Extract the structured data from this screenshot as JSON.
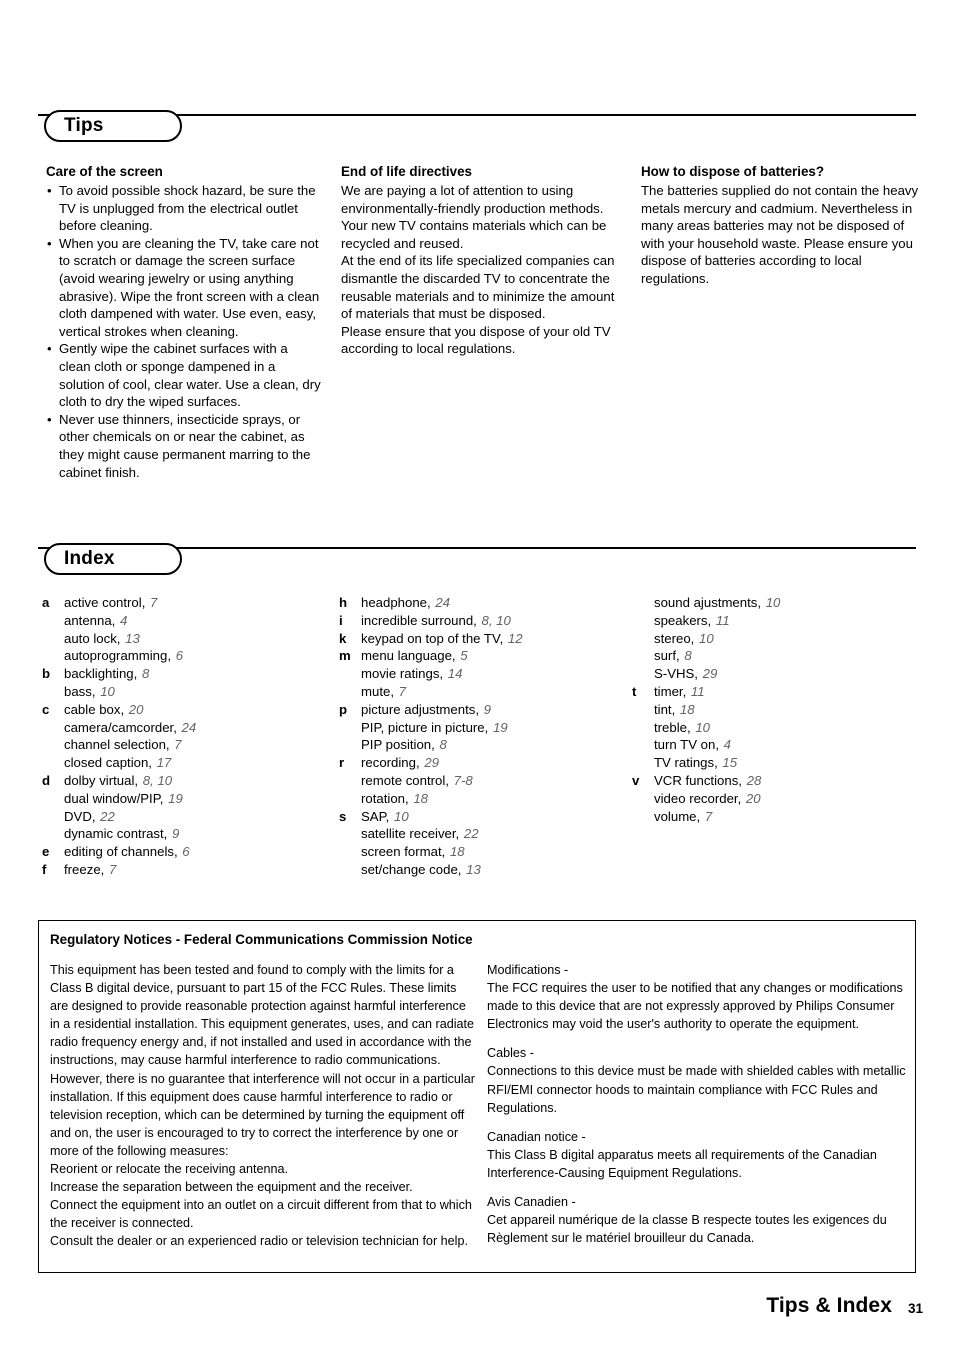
{
  "sections": {
    "tips": {
      "label": "Tips"
    },
    "index": {
      "label": "Index"
    }
  },
  "tips": {
    "care": {
      "heading": "Care of the screen",
      "bullets": [
        "To avoid possible shock hazard, be sure the TV is unplugged from the electrical outlet before cleaning.",
        "When you are cleaning the TV, take care not to scratch or damage the screen surface (avoid wearing jewelry or using anything abrasive). Wipe the front screen with a clean cloth dampened with water. Use even, easy, vertical strokes when cleaning.",
        "Gently wipe the cabinet surfaces with a clean cloth or sponge dampened in a solution of cool, clear water. Use a clean, dry cloth to dry the wiped surfaces.",
        "Never use thinners, insecticide sprays, or other chemicals on or near the cabinet, as they might cause permanent marring to the cabinet finish."
      ]
    },
    "end_of_life": {
      "heading": "End of life directives",
      "paragraphs": [
        "We are paying a lot of attention to using environmentally-friendly production methods. Your new TV contains materials which can be recycled and reused.",
        "At the end of its life specialized companies can dismantle the discarded TV to concentrate the reusable materials and to minimize the amount of materials that must be disposed.",
        "Please ensure that you dispose of your old TV according to local regulations."
      ]
    },
    "batteries": {
      "heading": "How to dispose of batteries?",
      "paragraphs": [
        "The batteries supplied do not contain the heavy metals mercury and cadmium. Nevertheless in many areas batteries may not be disposed of with your household waste. Please ensure you dispose of batteries according to local regulations."
      ]
    },
    "bullet_glyph": "•"
  },
  "index": {
    "column1": [
      {
        "letter": "a",
        "term": "active control,",
        "page": "7"
      },
      {
        "letter": "",
        "term": "antenna,",
        "page": "4"
      },
      {
        "letter": "",
        "term": "auto lock,",
        "page": "13"
      },
      {
        "letter": "",
        "term": "autoprogramming,",
        "page": "6"
      },
      {
        "letter": "b",
        "term": "backlighting,",
        "page": "8"
      },
      {
        "letter": "",
        "term": "bass,",
        "page": "10"
      },
      {
        "letter": "c",
        "term": "cable box,",
        "page": "20"
      },
      {
        "letter": "",
        "term": "camera/camcorder,",
        "page": "24"
      },
      {
        "letter": "",
        "term": "channel selection,",
        "page": "7"
      },
      {
        "letter": "",
        "term": "closed caption,",
        "page": "17"
      },
      {
        "letter": "d",
        "term": "dolby virtual,",
        "page": "8, 10"
      },
      {
        "letter": "",
        "term": "dual window/PIP,",
        "page": "19"
      },
      {
        "letter": "",
        "term": "DVD,",
        "page": "22"
      },
      {
        "letter": "",
        "term": "dynamic contrast,",
        "page": "9"
      },
      {
        "letter": "e",
        "term": "editing of channels,",
        "page": "6"
      },
      {
        "letter": "f",
        "term": "freeze,",
        "page": "7"
      }
    ],
    "column2": [
      {
        "letter": "h",
        "term": "headphone,",
        "page": "24"
      },
      {
        "letter": "i",
        "term": "incredible surround,",
        "page": "8, 10"
      },
      {
        "letter": "k",
        "term": "keypad on top of the TV,",
        "page": "12"
      },
      {
        "letter": "m",
        "term": "menu language,",
        "page": "5"
      },
      {
        "letter": "",
        "term": "movie ratings,",
        "page": "14"
      },
      {
        "letter": "",
        "term": "mute,",
        "page": "7"
      },
      {
        "letter": "p",
        "term": "picture adjustments,",
        "page": "9"
      },
      {
        "letter": "",
        "term": "PIP, picture in picture,",
        "page": "19"
      },
      {
        "letter": "",
        "term": "PIP position,",
        "page": "8"
      },
      {
        "letter": "r",
        "term": "recording,",
        "page": "29"
      },
      {
        "letter": "",
        "term": "remote control,",
        "page": "7-8"
      },
      {
        "letter": "",
        "term": "rotation,",
        "page": "18"
      },
      {
        "letter": "s",
        "term": "SAP,",
        "page": "10"
      },
      {
        "letter": "",
        "term": "satellite receiver,",
        "page": "22"
      },
      {
        "letter": "",
        "term": "screen format,",
        "page": "18"
      },
      {
        "letter": "",
        "term": "set/change code,",
        "page": "13"
      }
    ],
    "column3": [
      {
        "letter": "",
        "term": "sound ajustments,",
        "page": "10"
      },
      {
        "letter": "",
        "term": "speakers,",
        "page": "11"
      },
      {
        "letter": "",
        "term": "stereo,",
        "page": "10"
      },
      {
        "letter": "",
        "term": "surf,",
        "page": "8"
      },
      {
        "letter": "",
        "term": "S-VHS,",
        "page": "29"
      },
      {
        "letter": "t",
        "term": "timer,",
        "page": "11"
      },
      {
        "letter": "",
        "term": "tint,",
        "page": "18"
      },
      {
        "letter": "",
        "term": "treble,",
        "page": "10"
      },
      {
        "letter": "",
        "term": "turn TV on,",
        "page": "4"
      },
      {
        "letter": "",
        "term": "TV ratings,",
        "page": "15"
      },
      {
        "letter": "v",
        "term": "VCR functions,",
        "page": "28"
      },
      {
        "letter": "",
        "term": "video recorder,",
        "page": "20"
      },
      {
        "letter": "",
        "term": "volume,",
        "page": "7"
      }
    ]
  },
  "regulatory": {
    "title": "Regulatory Notices - Federal Communications Commission Notice",
    "left_paragraphs": [
      "This equipment has been tested and found to comply with the limits for a Class B digital device, pursuant to part 15 of the FCC Rules. These limits are designed to provide reasonable protection against harmful interference in a residential installation. This equipment generates, uses, and can radiate radio frequency energy and, if not installed and used in accordance with the instructions, may cause harmful interference to radio communications. However, there is no guarantee that interference will not occur in a particular installation. If this equipment does cause harmful interference to radio or television reception, which can be determined by turning the equipment off and on, the user is encouraged to try to correct the interference by one or more of the following measures:",
      "Reorient or relocate the receiving antenna.",
      "Increase the separation between the equipment and the receiver.",
      "Connect the equipment into an outlet on a circuit different from that to which the receiver is connected.",
      "Consult the dealer or an experienced radio or television technician for help."
    ],
    "right_blocks": [
      {
        "heading": "Modifications -",
        "body": "The FCC requires the user to be notified that any changes or modifications made to this device that are not expressly approved by Philips Consumer Electronics may void the user's authority to operate the equipment."
      },
      {
        "heading": "Cables -",
        "body": "Connections to this device must be made with shielded cables with metallic RFI/EMI connector hoods to maintain compliance with FCC Rules and Regulations."
      },
      {
        "heading": "Canadian notice -",
        "body": "This Class B digital apparatus meets all requirements of the Canadian Interference-Causing Equipment Regulations."
      },
      {
        "heading": "Avis Canadien -",
        "body": "Cet appareil numérique de la classe B respecte toutes les exigences du Règlement sur le matériel brouilleur du Canada."
      }
    ]
  },
  "footer": {
    "title": "Tips & Index",
    "page_number": "31"
  }
}
